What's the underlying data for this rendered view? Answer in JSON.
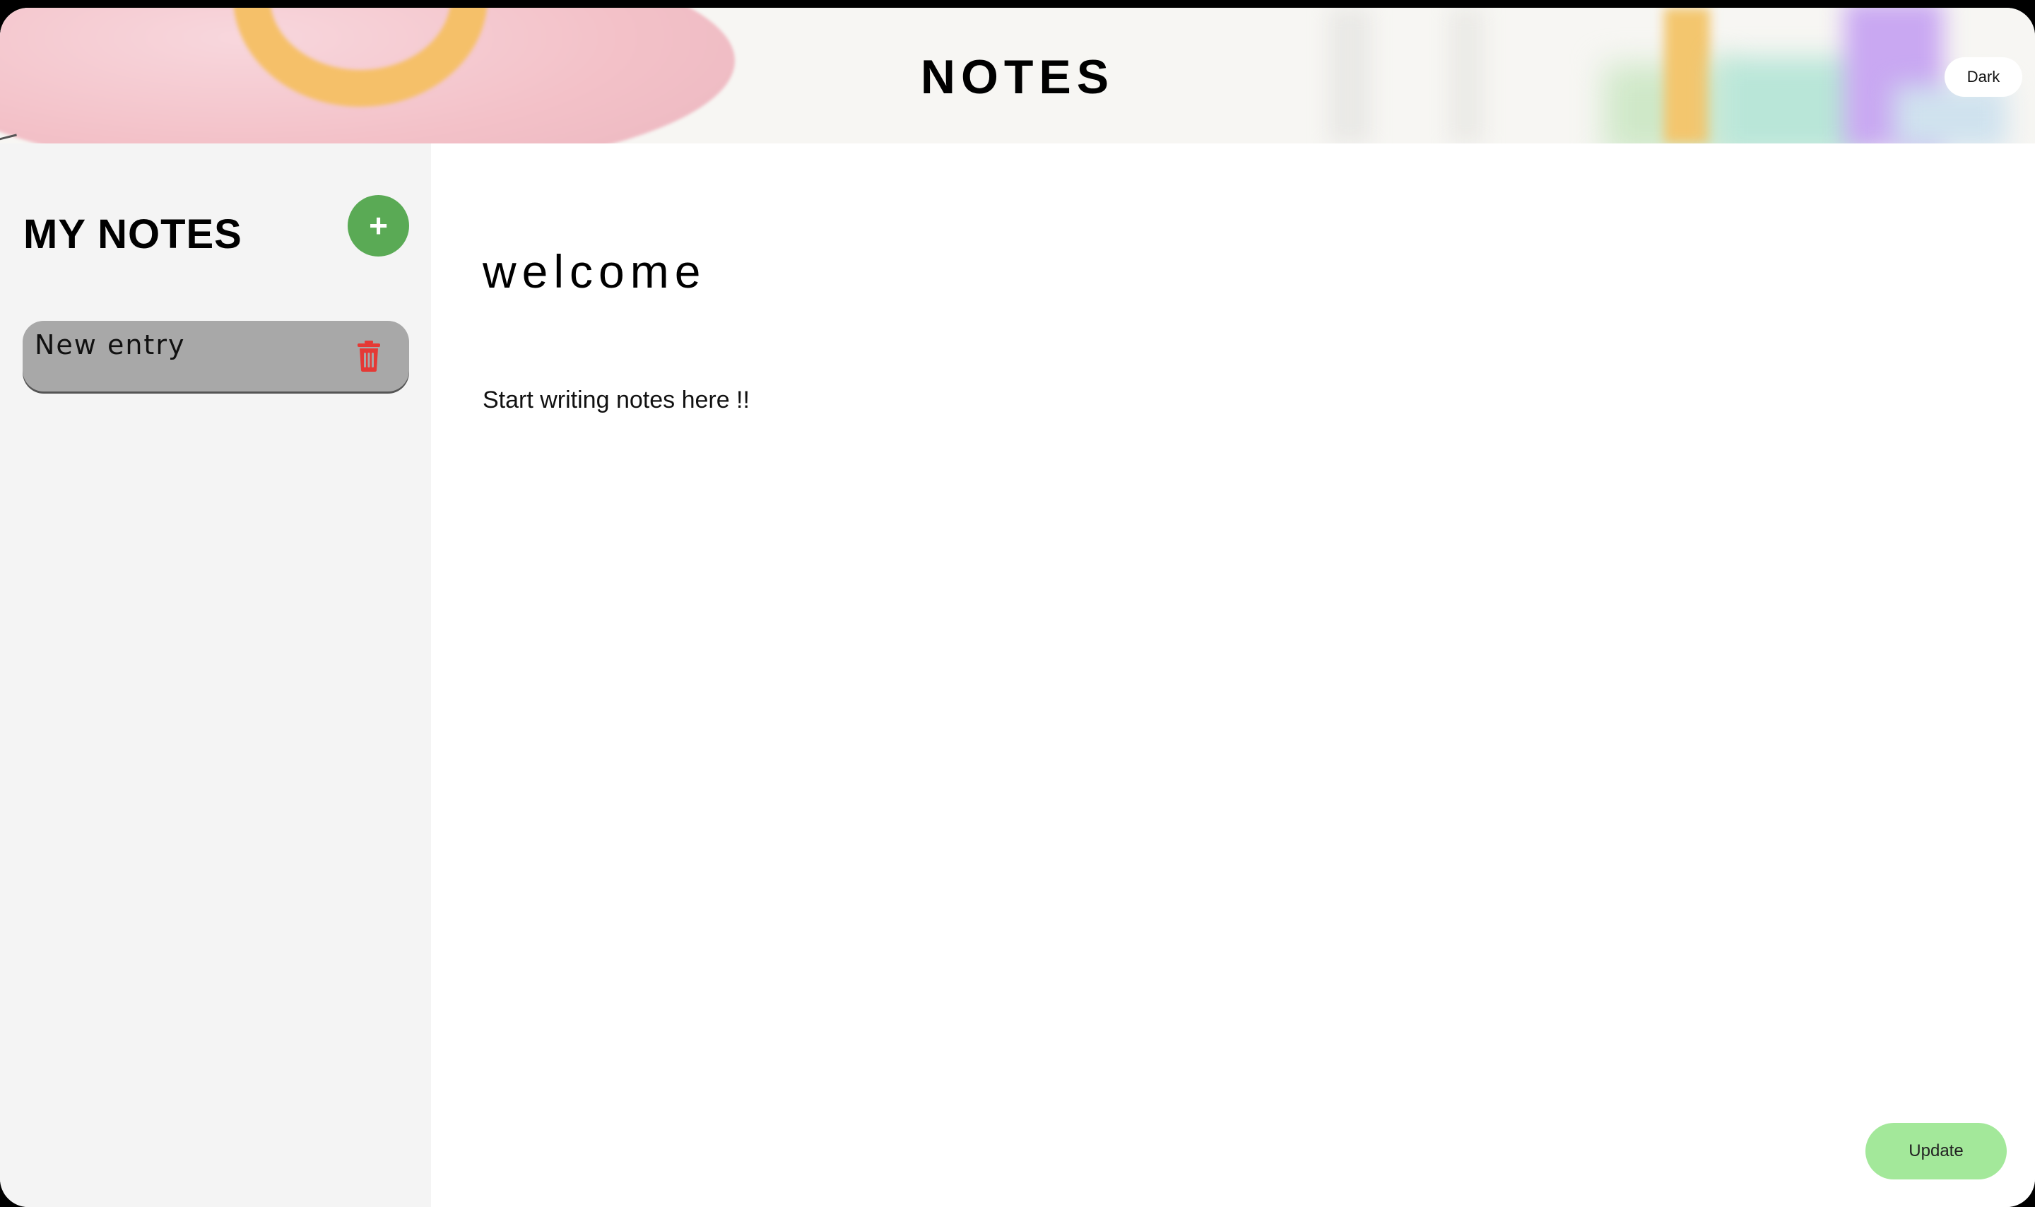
{
  "header": {
    "title": "NOTES",
    "theme_toggle_label": "Dark"
  },
  "sidebar": {
    "title": "MY NOTES",
    "add_icon": "plus-icon",
    "notes": [
      {
        "label": "New entry",
        "delete_icon": "trash-icon"
      }
    ]
  },
  "editor": {
    "title": "welcome",
    "body": "Start writing notes here !!",
    "update_label": "Update"
  },
  "colors": {
    "add_button": "#5aaa55",
    "update_button": "#a3e89a",
    "delete_icon": "#e53935",
    "note_item_bg": "#a8a8a8",
    "sidebar_bg": "#f4f4f4"
  }
}
